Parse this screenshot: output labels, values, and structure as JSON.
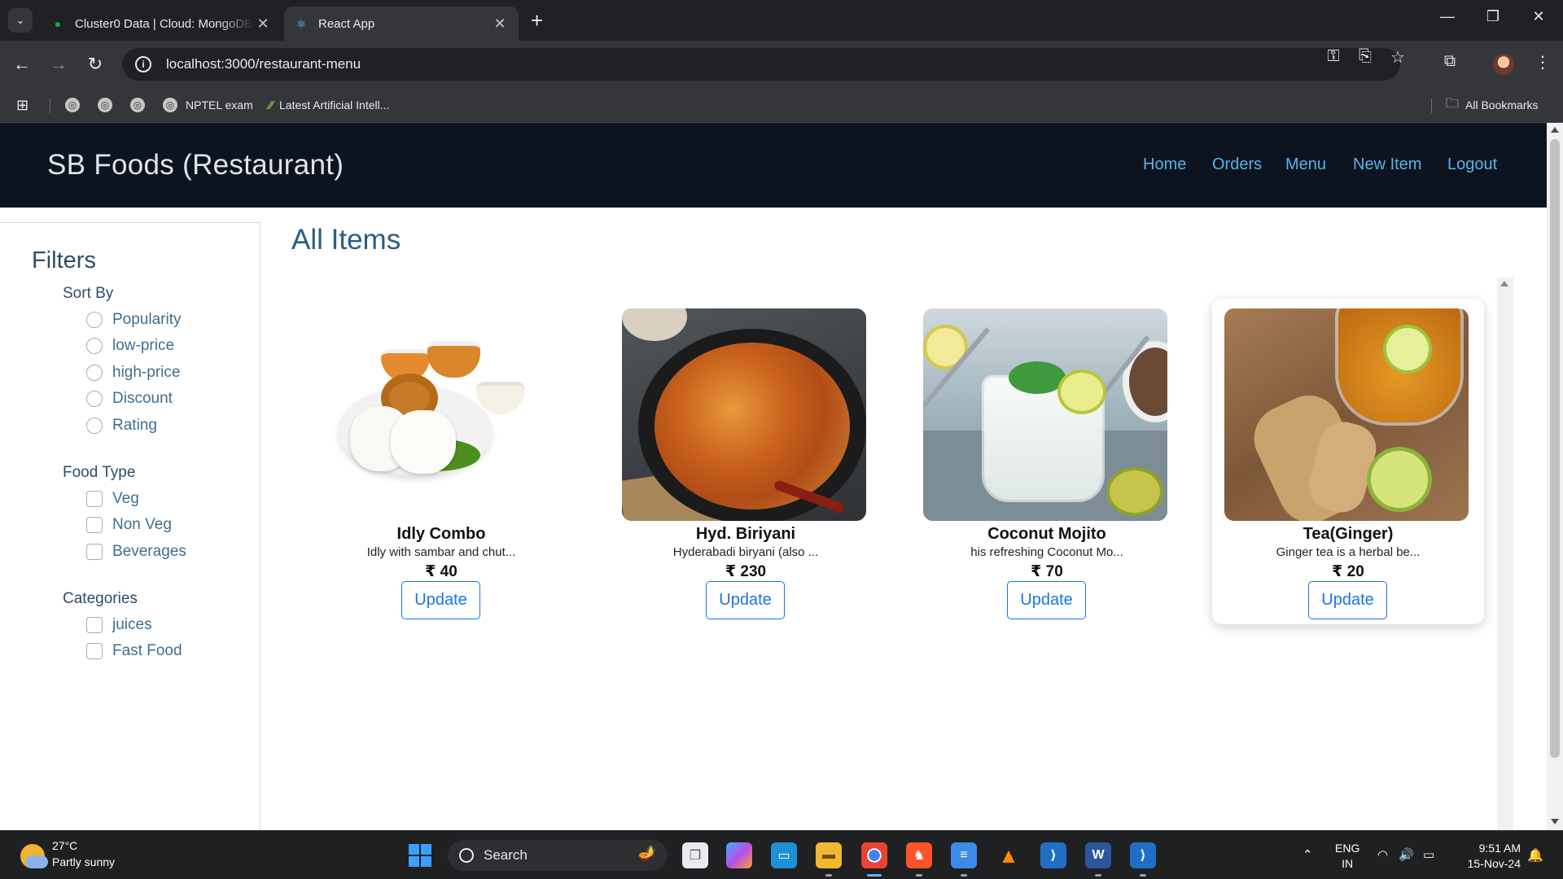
{
  "browser": {
    "tabs": [
      {
        "title": "Cluster0 Data | Cloud: MongoDB Cloud",
        "favicon": "mongodb-leaf-icon",
        "active": false
      },
      {
        "title": "React App",
        "favicon": "react-icon",
        "active": true
      }
    ],
    "url": "localhost:3000/restaurant-menu",
    "bookmarks": [
      {
        "label": "",
        "icon": "globe-icon"
      },
      {
        "label": "",
        "icon": "globe-icon"
      },
      {
        "label": "",
        "icon": "globe-icon"
      },
      {
        "label": "NPTEL exam",
        "icon": "globe-icon"
      },
      {
        "label": "Latest Artificial Intell...",
        "icon": "leaf-icon"
      }
    ],
    "all_bookmarks_label": "All Bookmarks"
  },
  "app": {
    "brand": "SB Foods (Restaurant)",
    "nav": [
      "Home",
      "Orders",
      "Menu",
      "New Item",
      "Logout"
    ],
    "nav_color": "#5bb1ea",
    "header_bg": "#0d1420"
  },
  "filters": {
    "title": "Filters",
    "sort_by": {
      "title": "Sort By",
      "options": [
        "Popularity",
        "low-price",
        "high-price",
        "Discount",
        "Rating"
      ]
    },
    "food_type": {
      "title": "Food Type",
      "options": [
        "Veg",
        "Non Veg",
        "Beverages"
      ]
    },
    "categories": {
      "title": "Categories",
      "options": [
        "juices",
        "Fast Food"
      ]
    }
  },
  "main": {
    "title": "All Items",
    "items": [
      {
        "name": "Idly Combo",
        "description": "Idly with sambar and chut...",
        "price": "₹ 40",
        "button": "Update"
      },
      {
        "name": "Hyd. Biriyani",
        "description": "Hyderabadi biryani (also ...",
        "price": "₹ 230",
        "button": "Update"
      },
      {
        "name": "Coconut Mojito",
        "description": "his refreshing Coconut Mo...",
        "price": "₹ 70",
        "button": "Update"
      },
      {
        "name": "Tea(Ginger)",
        "description": "Ginger tea is a herbal be...",
        "price": "₹ 20",
        "button": "Update"
      }
    ]
  },
  "taskbar": {
    "weather": {
      "temp": "27°C",
      "desc": "Partly sunny"
    },
    "search_placeholder": "Search",
    "language": {
      "line1": "ENG",
      "line2": "IN"
    },
    "clock": {
      "time": "9:51 AM",
      "date": "15-Nov-24"
    }
  }
}
